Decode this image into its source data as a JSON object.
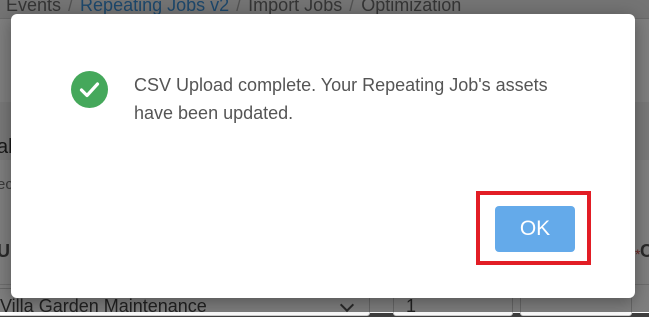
{
  "breadcrumb": {
    "items": [
      "Events",
      "Repeating Jobs v2",
      "Import Jobs",
      "Optimization"
    ],
    "separator": "/"
  },
  "background": {
    "left_fragment_1": "ab",
    "left_fragment_2": "ec",
    "left_fragment_3": "U",
    "right_fragment": "C",
    "row": {
      "select_value": "Villa Garden Maintenance",
      "number_value": "1"
    }
  },
  "modal": {
    "icon": "check-circle-icon",
    "message": "CSV Upload complete. Your Repeating Job's assets have been updated.",
    "ok_label": "OK"
  },
  "colors": {
    "success": "#45a85b",
    "button": "#64aaea",
    "highlight": "#e21d25",
    "breadcrumb_active": "#3a8fd6"
  }
}
